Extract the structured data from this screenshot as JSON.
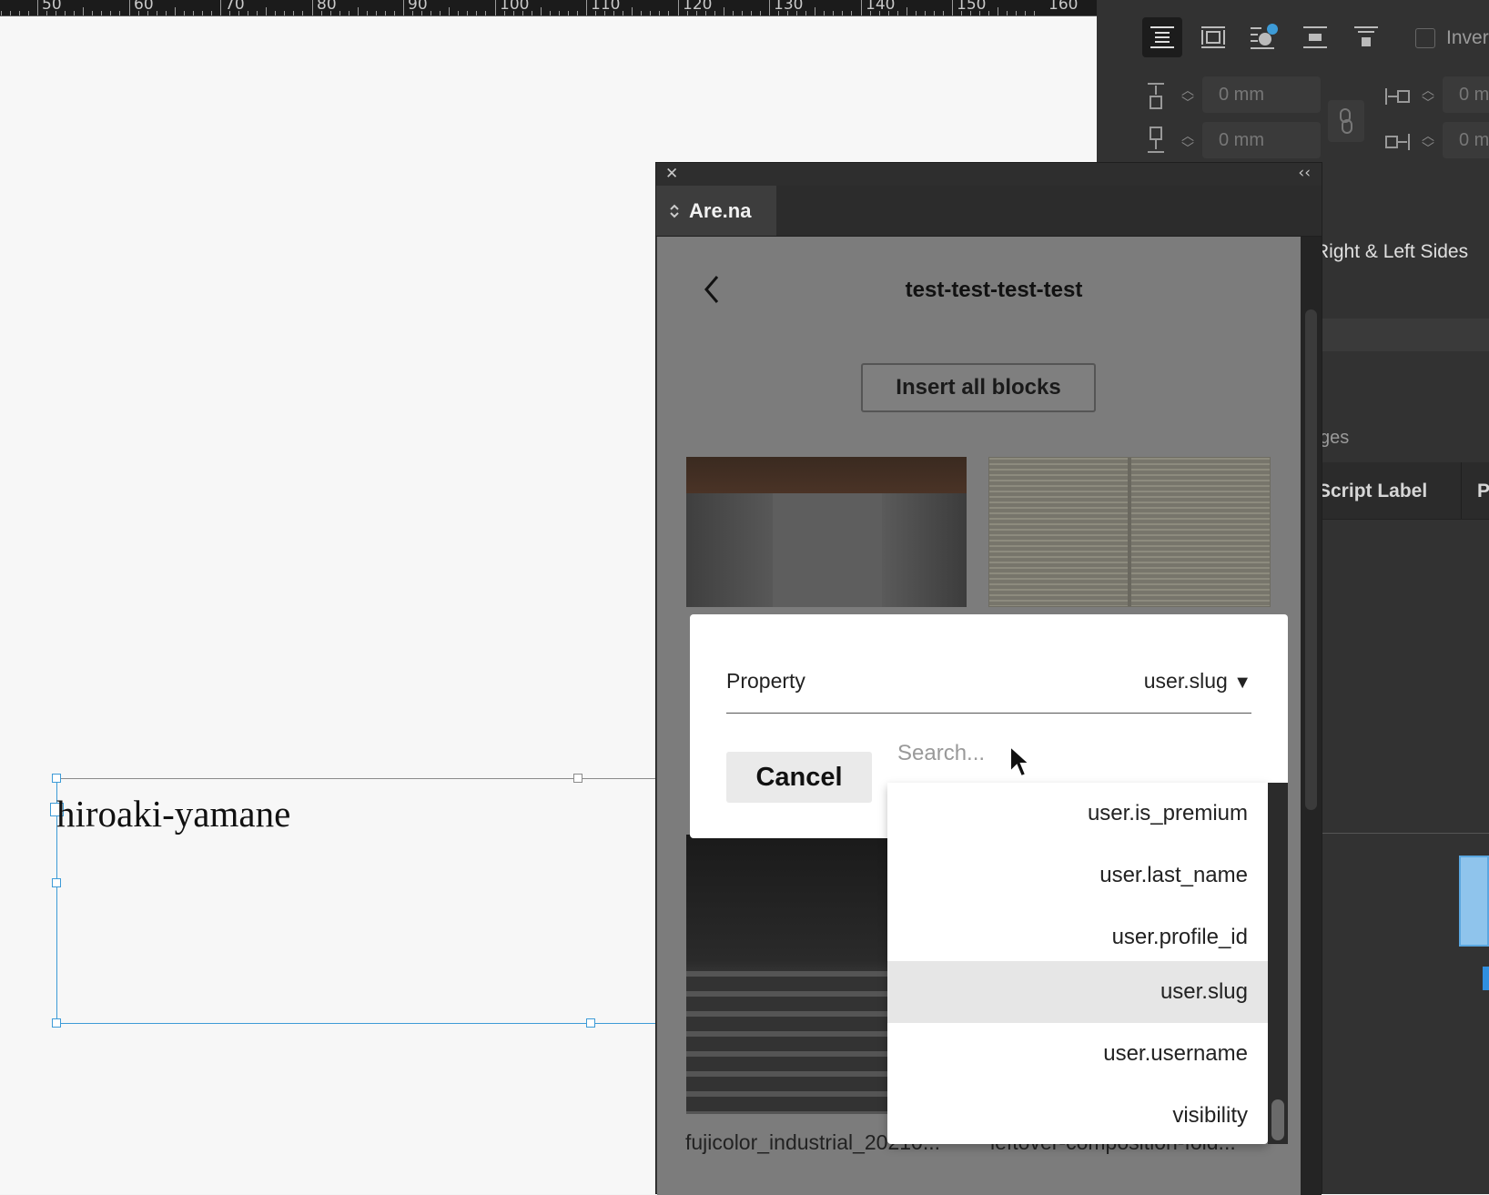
{
  "ruler": {
    "labels": [
      "50",
      "60",
      "70",
      "80",
      "90",
      "100",
      "110",
      "120",
      "130",
      "140",
      "150",
      "160"
    ]
  },
  "document": {
    "frame_text": "hiroaki-yamane"
  },
  "right_panel": {
    "invert_label": "Inver",
    "fields": [
      "0 mm",
      "0 mm",
      "0 m",
      "0 m"
    ],
    "right_left_sides": "Right & Left Sides",
    "ges_fragment": "ges",
    "script_label": "Script Label",
    "p_fragment": "P"
  },
  "plugin": {
    "close_glyph": "✕",
    "collapse_glyph": "‹‹",
    "tab_label": "Are.na",
    "channel_title": "test-test-test-test",
    "insert_all_label": "Insert all blocks",
    "captions": [
      "fujicolor_industrial_20210...",
      "leftover-composition-fold..."
    ]
  },
  "modal": {
    "property_label": "Property",
    "property_value": "user.slug",
    "dropdown_arrow": "▼",
    "cancel_label": "Cancel",
    "search_placeholder": "Search..."
  },
  "dropdown": {
    "items": [
      "user.is_premium",
      "user.last_name",
      "user.profile_id",
      "user.slug",
      "user.username",
      "visibility"
    ],
    "selected": "user.slug"
  },
  "colors": {
    "frame_blue": "#3d9bd7",
    "panel_dark": "#323232",
    "selected_row": "#e6e6e6"
  }
}
